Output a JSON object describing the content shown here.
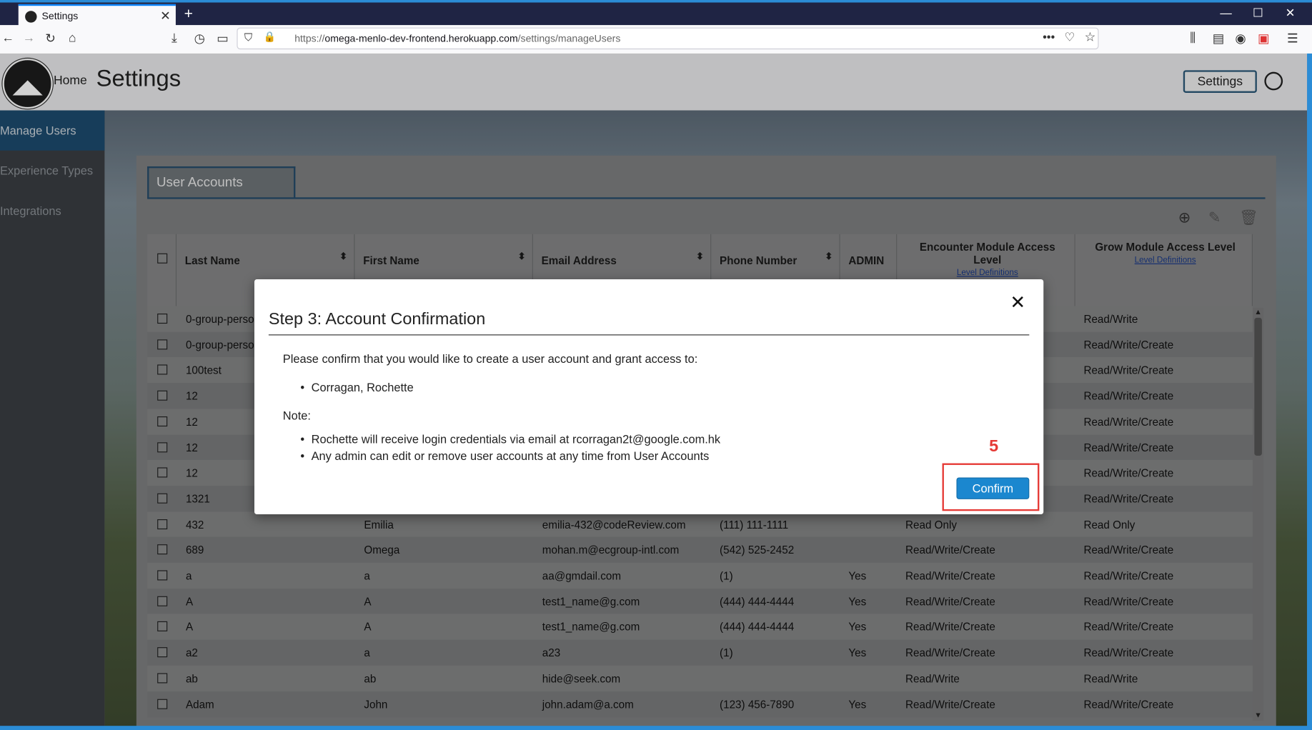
{
  "browser": {
    "tab_title": "Settings",
    "url_prefix": "https://",
    "url_host": "omega-menlo-dev-frontend.herokuapp.com",
    "url_path": "/settings/manageUsers"
  },
  "header": {
    "home": "Home",
    "title": "Settings",
    "settings_button": "Settings"
  },
  "sidebar": {
    "items": [
      {
        "label": "Manage Users"
      },
      {
        "label": "Experience Types"
      },
      {
        "label": "Integrations"
      }
    ]
  },
  "panel": {
    "tab": "User Accounts"
  },
  "table": {
    "columns": [
      "Last Name",
      "First Name",
      "Email Address",
      "Phone Number",
      "ADMIN",
      "Encounter Module Access Level",
      "Grow Module Access Level"
    ],
    "level_link": "Level Definitions",
    "rows": [
      {
        "last": "0-group-perso",
        "first": "",
        "email": "",
        "phone": "",
        "admin": "",
        "enc": "",
        "grow": "Read/Write"
      },
      {
        "last": "0-group-perso",
        "first": "",
        "email": "",
        "phone": "",
        "admin": "",
        "enc": "",
        "grow": "Read/Write/Create"
      },
      {
        "last": "100test",
        "first": "",
        "email": "",
        "phone": "",
        "admin": "",
        "enc": "",
        "grow": "Read/Write/Create"
      },
      {
        "last": "12",
        "first": "",
        "email": "",
        "phone": "",
        "admin": "",
        "enc": "",
        "grow": "Read/Write/Create"
      },
      {
        "last": "12",
        "first": "",
        "email": "",
        "phone": "",
        "admin": "",
        "enc": "",
        "grow": "Read/Write/Create"
      },
      {
        "last": "12",
        "first": "",
        "email": "",
        "phone": "",
        "admin": "",
        "enc": "",
        "grow": "Read/Write/Create"
      },
      {
        "last": "12",
        "first": "",
        "email": "",
        "phone": "",
        "admin": "",
        "enc": "",
        "grow": "Read/Write/Create"
      },
      {
        "last": "1321",
        "first": "",
        "email": "",
        "phone": "",
        "admin": "",
        "enc": "",
        "grow": "Read/Write/Create"
      },
      {
        "last": "432",
        "first": "Emilia",
        "email": "emilia-432@codeReview.com",
        "phone": "(111) 111-1111",
        "admin": "",
        "enc": "Read Only",
        "grow": "Read Only"
      },
      {
        "last": "689",
        "first": "Omega",
        "email": "mohan.m@ecgroup-intl.com",
        "phone": "(542) 525-2452",
        "admin": "",
        "enc": "Read/Write/Create",
        "grow": "Read/Write/Create"
      },
      {
        "last": "a",
        "first": "a",
        "email": "aa@gmdail.com",
        "phone": "(1)",
        "admin": "Yes",
        "enc": "Read/Write/Create",
        "grow": "Read/Write/Create"
      },
      {
        "last": "A",
        "first": "A",
        "email": "test1_name@g.com",
        "phone": "(444) 444-4444",
        "admin": "Yes",
        "enc": "Read/Write/Create",
        "grow": "Read/Write/Create"
      },
      {
        "last": "A",
        "first": "A",
        "email": "test1_name@g.com",
        "phone": "(444) 444-4444",
        "admin": "Yes",
        "enc": "Read/Write/Create",
        "grow": "Read/Write/Create"
      },
      {
        "last": "a2",
        "first": "a",
        "email": "a23",
        "phone": "(1)",
        "admin": "Yes",
        "enc": "Read/Write/Create",
        "grow": "Read/Write/Create"
      },
      {
        "last": "ab",
        "first": "ab",
        "email": "hide@seek.com",
        "phone": "",
        "admin": "",
        "enc": "Read/Write",
        "grow": "Read/Write"
      },
      {
        "last": "Adam",
        "first": "John",
        "email": "john.adam@a.com",
        "phone": "(123) 456-7890",
        "admin": "Yes",
        "enc": "Read/Write/Create",
        "grow": "Read/Write/Create"
      }
    ]
  },
  "modal": {
    "title": "Step 3: Account Confirmation",
    "intro": "Please confirm that you would like to create a user account and grant access to:",
    "user": "Corragan, Rochette",
    "note_label": "Note:",
    "note1": "Rochette will receive login credentials via email at rcorragan2t@google.com.hk",
    "note2": "Any admin can edit or remove user accounts at any time from User Accounts",
    "confirm": "Confirm",
    "close_glyph": "✕"
  },
  "annotation": {
    "step": "5",
    "color": "#e53935"
  }
}
